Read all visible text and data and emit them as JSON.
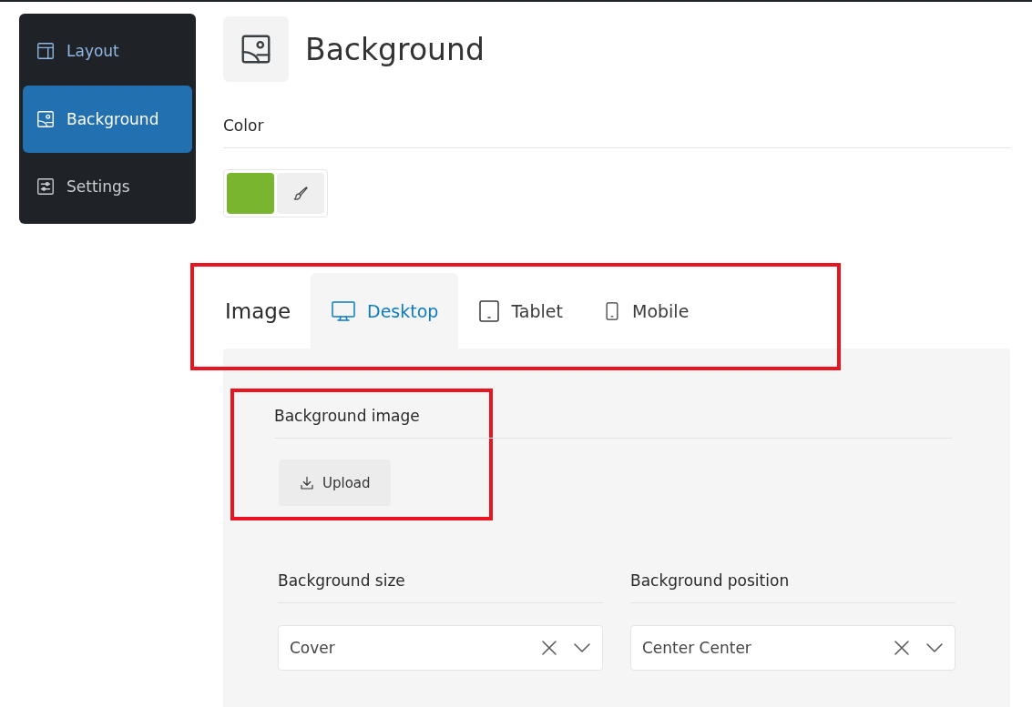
{
  "sidebar": {
    "items": [
      {
        "label": "Layout",
        "kind": "layout",
        "selected": false
      },
      {
        "label": "Background",
        "kind": "image",
        "selected": true
      },
      {
        "label": "Settings",
        "kind": "sliders",
        "selected": false
      }
    ]
  },
  "header": {
    "title": "Background"
  },
  "color": {
    "label": "Color",
    "color": "#7ab530"
  },
  "image": {
    "label": "Image",
    "highlighted": true,
    "tabs": [
      {
        "label": "Desktop",
        "kind": "desktop",
        "selected": true
      },
      {
        "label": "Tablet",
        "kind": "tablet",
        "selected": false
      },
      {
        "label": "Mobile",
        "kind": "mobile",
        "selected": false
      }
    ],
    "background_image": {
      "label": "Background image",
      "button": "Upload",
      "highlighted": true
    },
    "selects": [
      {
        "label": "Background size",
        "value": "Cover"
      },
      {
        "label": "Background position",
        "value": "Center Center"
      }
    ]
  }
}
